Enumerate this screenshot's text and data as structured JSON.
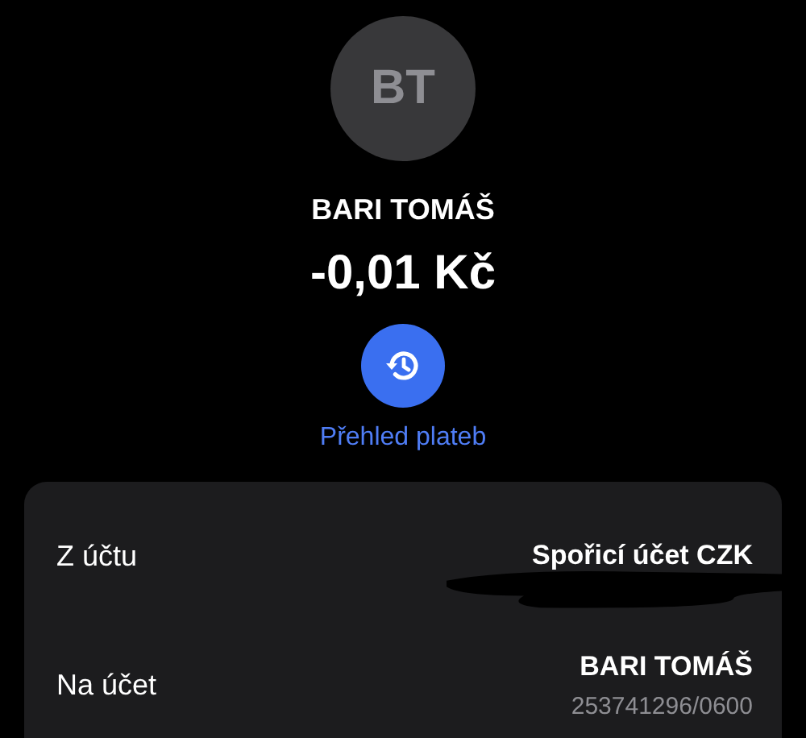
{
  "avatar": {
    "initials": "BT"
  },
  "recipient": {
    "name": "BARI TOMÁŠ"
  },
  "amount": "-0,01 Kč",
  "history_link": {
    "label": "Přehled plateb"
  },
  "details": [
    {
      "label": "Z účtu",
      "value": "Spořicí účet CZK",
      "redacted": true
    },
    {
      "label": "Na účet",
      "value": "BARI TOMÁŠ",
      "detail": "253741296/0600",
      "redacted": false
    }
  ]
}
